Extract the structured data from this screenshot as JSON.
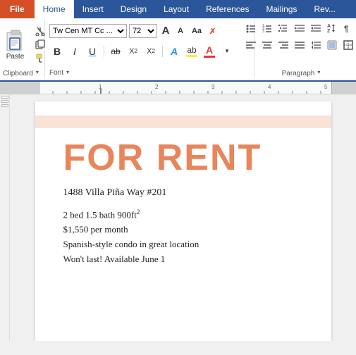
{
  "tabs": {
    "file": "File",
    "home": "Home",
    "insert": "Insert",
    "design": "Design",
    "layout": "Layout",
    "references": "References",
    "mailings": "Mailings",
    "review": "Rev..."
  },
  "clipboard": {
    "paste_label": "Paste",
    "group_label": "Clipboard",
    "expand_icon": "▾"
  },
  "font": {
    "family": "Tw Cen MT Cc ...",
    "size": "72",
    "grow_label": "A",
    "shrink_label": "A",
    "aa_label": "Aa",
    "clear_label": "✗",
    "bold_label": "B",
    "italic_label": "I",
    "underline_label": "U",
    "strikethrough_label": "ab",
    "subscript_label": "X₂",
    "superscript_label": "X²",
    "text_effects_label": "A",
    "highlight_label": "ab",
    "font_color_label": "A",
    "group_label": "Font",
    "expand_icon": "▾"
  },
  "paragraph": {
    "group_label": "Paragraph",
    "expand_icon": "▾"
  },
  "document": {
    "pink_bar": true,
    "heading": "FOR RENT",
    "address": "1488 Villa Piña Way #201",
    "detail1": "2 bed 1.5 bath 900ft²",
    "detail2": "$1,550 per month",
    "detail3": "Spanish-style condo in great location",
    "detail4": "Won't last! Available June 1"
  },
  "colors": {
    "for_rent": "#e8855a",
    "tab_active_bg": "#ffffff",
    "tab_active_color": "#2b579a",
    "ribbon_bg": "#2b579a",
    "file_tab": "#d44f26",
    "pink_bar": "#f5c6b0",
    "underline_color": "#2196f3",
    "highlight_yellow": "#ffeb3b",
    "font_color_red": "#e53935"
  }
}
